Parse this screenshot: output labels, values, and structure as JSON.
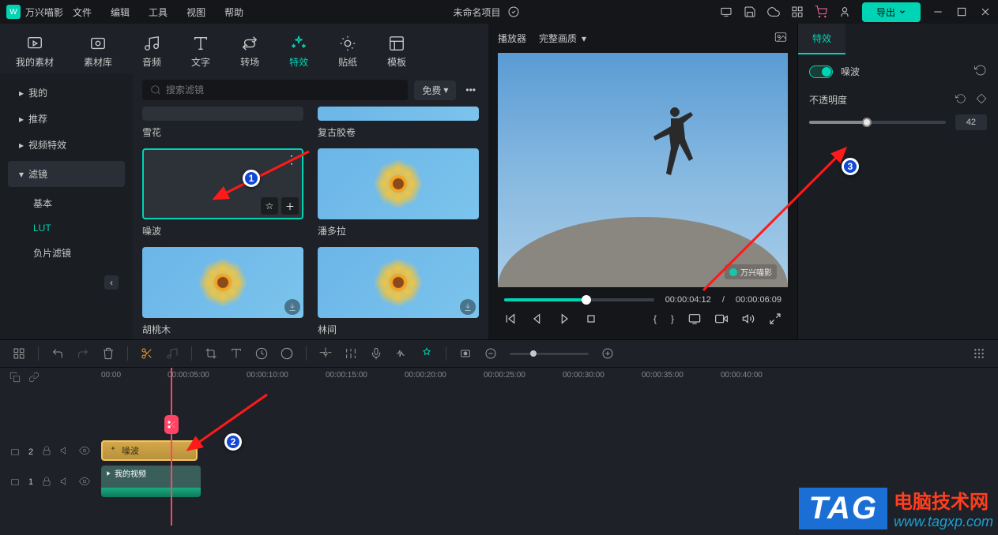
{
  "titlebar": {
    "app_name": "万兴喵影",
    "menus": [
      "文件",
      "编辑",
      "工具",
      "视图",
      "帮助"
    ],
    "project_title": "未命名项目",
    "export_label": "导出"
  },
  "tabs": [
    {
      "label": "我的素材"
    },
    {
      "label": "素材库"
    },
    {
      "label": "音频"
    },
    {
      "label": "文字"
    },
    {
      "label": "转场"
    },
    {
      "label": "特效",
      "active": true
    },
    {
      "label": "贴纸"
    },
    {
      "label": "模板"
    }
  ],
  "sidebar": {
    "items": [
      {
        "label": "我的"
      },
      {
        "label": "推荐"
      },
      {
        "label": "视频特效"
      },
      {
        "label": "滤镜",
        "selected": true
      }
    ],
    "subs": [
      {
        "label": "基本"
      },
      {
        "label": "LUT",
        "active": true
      },
      {
        "label": "负片滤镜"
      }
    ]
  },
  "search": {
    "placeholder": "搜索滤镜",
    "tag": "免费"
  },
  "thumbs": [
    {
      "label": "雪花",
      "variant": "dark",
      "partial": true
    },
    {
      "label": "复古胶卷",
      "variant": "flower",
      "partial": true
    },
    {
      "label": "噪波",
      "variant": "dark",
      "selected": true,
      "actions": true
    },
    {
      "label": "潘多拉",
      "variant": "flower"
    },
    {
      "label": "胡桃木",
      "variant": "flower",
      "download": true
    },
    {
      "label": "林间",
      "variant": "flower",
      "download": true
    }
  ],
  "preview": {
    "player_label": "播放器",
    "quality_label": "完整画质",
    "watermark": "万兴喵影",
    "current_time": "00:00:04:12",
    "total_time": "00:00:06:09"
  },
  "props": {
    "tab": "特效",
    "effect_name": "噪波",
    "opacity_label": "不透明度",
    "opacity_value": "42"
  },
  "timeline": {
    "ruler": [
      "00:00",
      "00:00:05:00",
      "00:00:10:00",
      "00:00:15:00",
      "00:00:20:00",
      "00:00:25:00",
      "00:00:30:00",
      "00:00:35:00",
      "00:00:40:00"
    ],
    "track1_index": "2",
    "track2_index": "1",
    "clip_fx_label": "噪波",
    "clip_video_label": "我的视频"
  },
  "annotations": {
    "a1": "1",
    "a2": "2",
    "a3": "3"
  },
  "watermark_overlay": {
    "tag": "TAG",
    "line1": "电脑技术网",
    "line2": "www.tagxp.com"
  }
}
